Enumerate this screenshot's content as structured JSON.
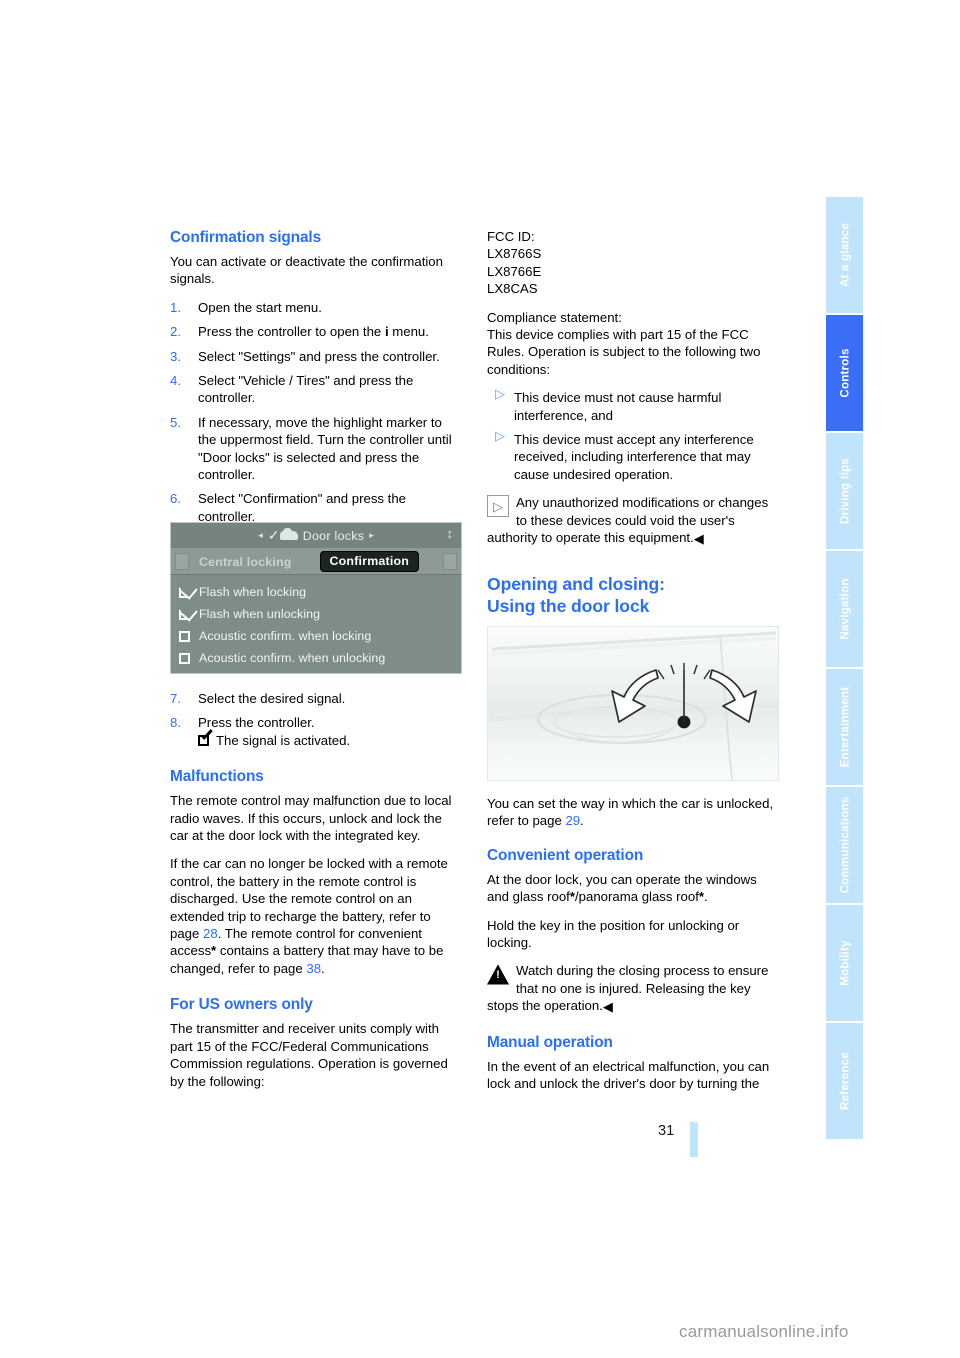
{
  "page": {
    "number": "31",
    "watermark": "carmanualsonline.info"
  },
  "sidebar": {
    "active": "Controls",
    "items": [
      {
        "label": "At a glance",
        "active": false
      },
      {
        "label": "Controls",
        "active": true
      },
      {
        "label": "Driving tips",
        "active": false
      },
      {
        "label": "Navigation",
        "active": false
      },
      {
        "label": "Entertainment",
        "active": false
      },
      {
        "label": "Communications",
        "active": false
      },
      {
        "label": "Mobility",
        "active": false
      },
      {
        "label": "Reference",
        "active": false
      }
    ]
  },
  "colors": {
    "heading_blue": "#2b6ff5",
    "tab_active": "#3a6ef6",
    "tab_inactive": "#bfe4fb",
    "idrive_bg": "#7e8c8a"
  },
  "left_column": {
    "heading_confirmation": "Confirmation signals",
    "intro": "You can activate or deactivate the confirmation signals.",
    "steps": [
      {
        "num": "1.",
        "text": "Open the start menu."
      },
      {
        "num": "2.",
        "text_before": "Press the controller to open the ",
        "glyph": "i",
        "text_after": " menu."
      },
      {
        "num": "3.",
        "text": "Select \"Settings\" and press the controller."
      },
      {
        "num": "4.",
        "text": "Select \"Vehicle / Tires\" and press the controller."
      },
      {
        "num": "5.",
        "text": "If necessary, move the highlight marker to the uppermost field. Turn the controller until \"Door locks\" is selected and press the controller."
      },
      {
        "num": "6.",
        "text": "Select \"Confirmation\" and press the controller."
      }
    ],
    "steps_after": [
      {
        "num": "7.",
        "text": "Select the desired signal."
      },
      {
        "num": "8.",
        "text": "Press the controller.",
        "sub": "The signal is activated."
      }
    ],
    "heading_malfunctions": "Malfunctions",
    "malfunction_p1": "The remote control may malfunction due to local radio waves. If this occurs, unlock and lock the car at the door lock with the integrated key.",
    "malfunction_p2_a": "If the car can no longer be locked with a remote control, the battery in the remote control is discharged. Use the remote control on an extended trip to recharge the battery, refer to page ",
    "malfunction_p2_page1": "28",
    "malfunction_p2_b": ". The remote control for convenient access",
    "malfunction_p2_star": "*",
    "malfunction_p2_c": " contains a battery that may have to be changed, refer to page ",
    "malfunction_p2_page2": "38",
    "malfunction_p2_d": ".",
    "heading_us_owners": "For US owners only",
    "us_owners_text": "The transmitter and receiver units comply with part 15 of the FCC/Federal Communications Commission regulations. Operation is governed by the following:"
  },
  "idrive_screen": {
    "title": "Door locks",
    "arrow_left": "◂",
    "arrow_right": "▸",
    "tabs": [
      {
        "label": "Central locking",
        "selected": false
      },
      {
        "label": "Confirmation",
        "selected": true
      }
    ],
    "options": [
      {
        "label": "Flash when locking",
        "checked": true
      },
      {
        "label": "Flash when unlocking",
        "checked": true
      },
      {
        "label": "Acoustic confirm. when locking",
        "checked": false
      },
      {
        "label": "Acoustic confirm. when unlocking",
        "checked": false
      }
    ]
  },
  "right_column": {
    "fcc_id_label": "FCC ID:",
    "fcc_ids": [
      "LX8766S",
      "LX8766E",
      "LX8CAS"
    ],
    "compliance_label": "Compliance statement:",
    "compliance_text": "This device complies with part 15 of the FCC Rules. Operation is subject to the following two conditions:",
    "conditions": [
      "This device must not cause harmful interference, and",
      "This device must accept any interference received, including interference that may cause undesired operation."
    ],
    "note_text": "Any unauthorized modifications or changes to these devices could void the user's authority to operate this equipment.",
    "note_end": "◀",
    "heading_opening_line1": "Opening and closing:",
    "heading_opening_line2": "Using the door lock",
    "after_figure_a": "You can set the way in which the car is unlocked, refer to page ",
    "after_figure_page": "29",
    "after_figure_b": ".",
    "heading_convenient": "Convenient operation",
    "convenient_p1_a": "At the door lock, you can operate the windows and glass roof",
    "convenient_p1_star1": "*",
    "convenient_p1_b": "/panorama glass roof",
    "convenient_p1_star2": "*",
    "convenient_p1_c": ".",
    "convenient_p2": "Hold the key in the position for unlocking or locking.",
    "warning_text": "Watch during the closing process to ensure that no one is injured. Releasing the key stops the operation.",
    "warning_end": "◀",
    "heading_manual": "Manual operation",
    "manual_text": "In the event of an electrical malfunction, you can lock and unlock the driver's door by turning the"
  }
}
